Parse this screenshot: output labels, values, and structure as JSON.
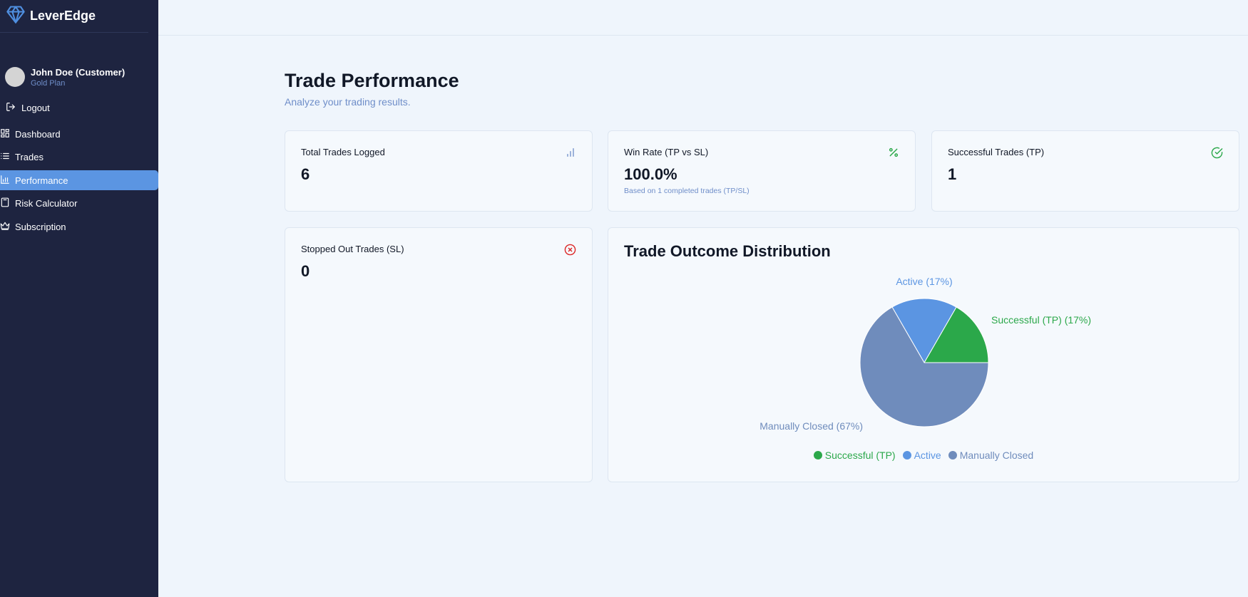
{
  "app": {
    "name": "LeverEdge"
  },
  "user": {
    "name": "John Doe (Customer)",
    "plan": "Gold Plan"
  },
  "sidebar": {
    "logout_label": "Logout",
    "items": [
      {
        "label": "Dashboard",
        "icon": "dashboard-icon"
      },
      {
        "label": "Trades",
        "icon": "list-icon"
      },
      {
        "label": "Performance",
        "icon": "bar-chart-icon",
        "active": true
      },
      {
        "label": "Risk Calculator",
        "icon": "calculator-icon"
      },
      {
        "label": "Subscription",
        "icon": "crown-icon"
      }
    ]
  },
  "page": {
    "title": "Trade Performance",
    "subtitle": "Analyze your trading results."
  },
  "stats": {
    "total": {
      "label": "Total Trades Logged",
      "value": "6",
      "icon": "bar-chart-icon"
    },
    "winrate": {
      "label": "Win Rate (TP vs SL)",
      "value": "100.0%",
      "note": "Based on 1 completed trades (TP/SL)",
      "icon": "percent-icon"
    },
    "successful": {
      "label": "Successful Trades (TP)",
      "value": "1",
      "icon": "check-circle-icon"
    },
    "stopped": {
      "label": "Stopped Out Trades (SL)",
      "value": "0",
      "icon": "x-circle-icon"
    }
  },
  "colors": {
    "sidebar_bg": "#1e2440",
    "accent": "#5b95e2",
    "success": "#2ba84a",
    "danger": "#dc2626",
    "muted": "#6f8ec9",
    "manual": "#6f8cbc"
  },
  "chart_data": {
    "type": "pie",
    "title": "Trade Outcome Distribution",
    "slices": [
      {
        "name": "Successful (TP)",
        "value": 1,
        "label": "Successful (TP) (17%)",
        "color": "#2ba84a"
      },
      {
        "name": "Active",
        "value": 1,
        "label": "Active (17%)",
        "color": "#5b95e2"
      },
      {
        "name": "Manually Closed",
        "value": 4,
        "label": "Manually Closed (67%)",
        "color": "#6f8cbc"
      }
    ],
    "legend": [
      "Successful (TP)",
      "Active",
      "Manually Closed"
    ],
    "legend_position": "bottom"
  }
}
